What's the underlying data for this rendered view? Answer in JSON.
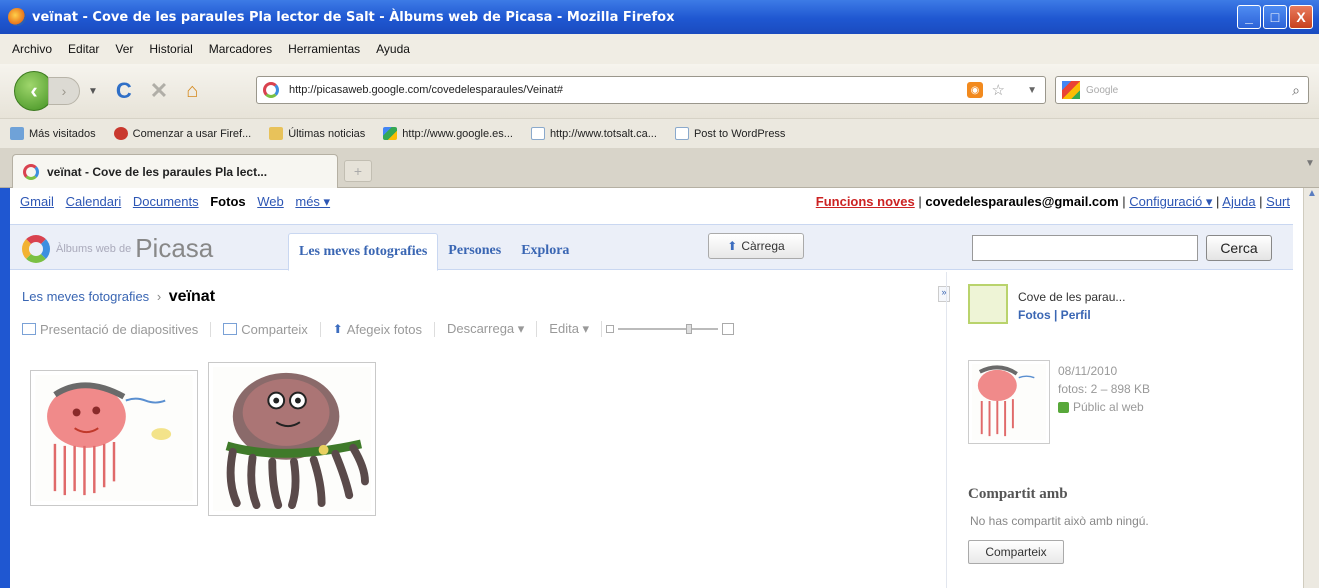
{
  "window": {
    "title": "veïnat - Cove de les paraules Pla lector de Salt - Àlbums web de Picasa - Mozilla Firefox",
    "min_label": "_",
    "max_label": "□",
    "close_label": "X"
  },
  "menubar": [
    "Archivo",
    "Editar",
    "Ver",
    "Historial",
    "Marcadores",
    "Herramientas",
    "Ayuda"
  ],
  "navbar": {
    "url": "http://picasaweb.google.com/covedelesparaules/Veinat#",
    "search_placeholder": "Google"
  },
  "bookmarks": [
    {
      "label": "Más visitados",
      "icon": "blue"
    },
    {
      "label": "Comenzar a usar Firef...",
      "icon": "red"
    },
    {
      "label": "Últimas noticias",
      "icon": "fold"
    },
    {
      "label": "http://www.google.es...",
      "icon": "goog"
    },
    {
      "label": "http://www.totsalt.ca...",
      "icon": "page"
    },
    {
      "label": "Post to WordPress",
      "icon": "page"
    }
  ],
  "tab": {
    "label": "veïnat - Cove de les paraules Pla lect..."
  },
  "gbar": {
    "left": [
      "Gmail",
      "Calendari",
      "Documents"
    ],
    "current": "Fotos",
    "web": "Web",
    "more": "més ▾",
    "new_features": "Funcions noves",
    "sep1": " | ",
    "email": "covedelesparaules@gmail.com",
    "sep2": " | ",
    "settings": "Configuració ▾",
    "sep3": " | ",
    "help": "Ajuda",
    "sep4": " | ",
    "signout": "Surt"
  },
  "picasa": {
    "logo_small": "Àlbums web de",
    "logo_big": "Picasa",
    "tabs": [
      "Les meves fotografies",
      "Persones",
      "Explora"
    ],
    "upload": "Càrrega",
    "search_button": "Cerca"
  },
  "breadcrumb": {
    "parent": "Les meves fotografies",
    "sep": "›",
    "current": "veïnat"
  },
  "toolbar": {
    "slideshow": "Presentació de diapositives",
    "share": "Comparteix",
    "add": "Afegeix fotos",
    "download": "Descarrega ▾",
    "edit": "Edita ▾"
  },
  "sidebar": {
    "owner": "Cove de les parau...",
    "owner_links": "Fotos | Perfil",
    "date": "08/11/2010",
    "count": "fotos: 2 – 898 KB",
    "visibility": "Públic al web",
    "shared_heading": "Compartit amb",
    "shared_text": "No has compartit això amb ningú.",
    "share_button": "Comparteix"
  },
  "colors": {
    "titlebar": "#1f57d1",
    "link": "#3a66b3",
    "new_features": "#cc2222"
  }
}
